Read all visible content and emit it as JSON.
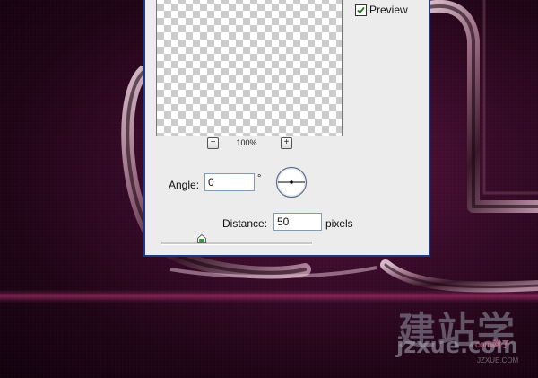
{
  "preview": {
    "label": "Preview",
    "checked": true
  },
  "zoom": {
    "out_symbol": "−",
    "in_symbol": "+",
    "level": "100%"
  },
  "angle": {
    "label": "Angle:",
    "value": "0",
    "unit": "°"
  },
  "distance": {
    "label": "Distance:",
    "value": "50",
    "unit": "pixels",
    "slider_fraction": 0.27
  },
  "watermark": {
    "chinese": "建站学",
    "latin": "jzxue.com",
    "domain": "com网子",
    "sub": "JZXUE.COM"
  },
  "colors": {
    "dialog_border": "#1b3a8c",
    "dialog_bg": "#ececec",
    "background": "#3a0b2a",
    "slider_thumb": "#2e9a3a"
  },
  "icons": {
    "checkbox": "checkmark-icon",
    "dial": "angle-dial-icon",
    "slider": "slider-thumb-icon"
  }
}
